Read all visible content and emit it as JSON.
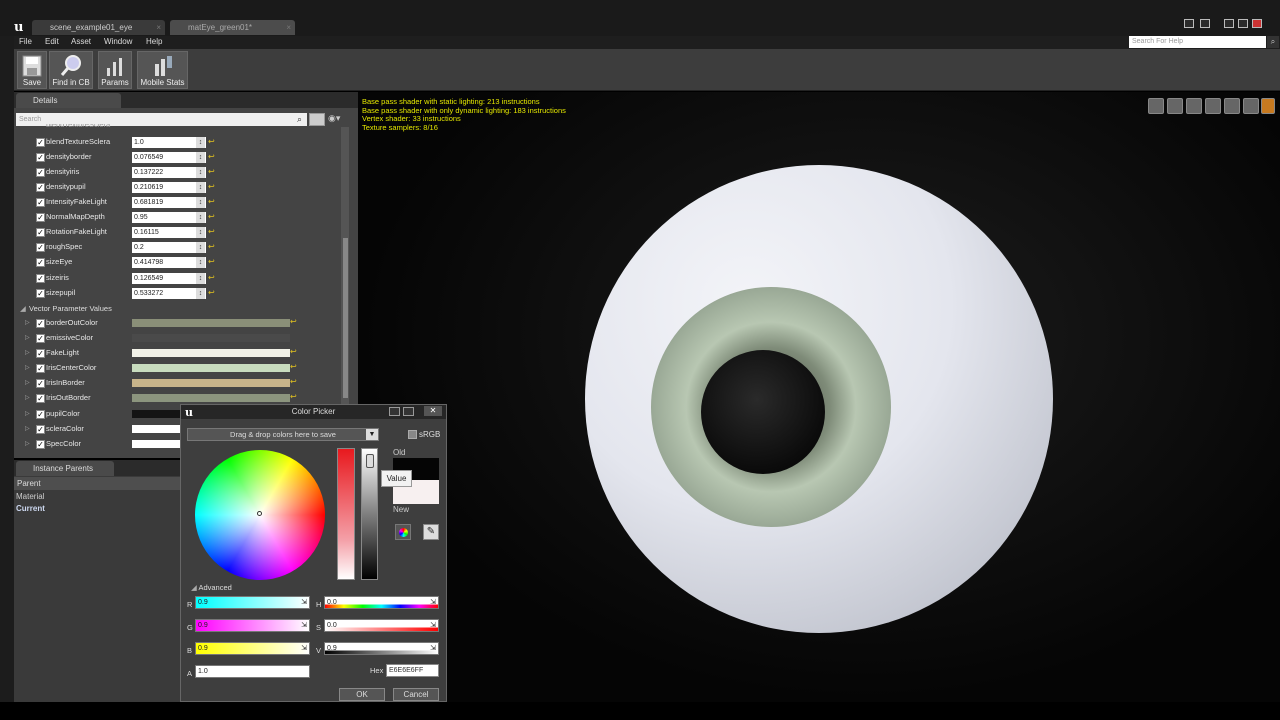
{
  "tabs": [
    {
      "label": "scene_example01_eye"
    },
    {
      "label": "matEye_green01*"
    }
  ],
  "menu": [
    "File",
    "Edit",
    "Asset",
    "Window",
    "Help"
  ],
  "help_search_placeholder": "Search For Help",
  "toolbar": [
    {
      "label": "Save"
    },
    {
      "label": "Find in CB"
    },
    {
      "label": "Params"
    },
    {
      "label": "Mobile Stats"
    }
  ],
  "details": {
    "tab": "Details",
    "search_placeholder": "Search",
    "partial_top": "blendTextureSclera",
    "scalars": [
      {
        "name": "blendTextureSclera",
        "value": "1.0"
      },
      {
        "name": "densityborder",
        "value": "0.076549"
      },
      {
        "name": "densityiris",
        "value": "0.137222"
      },
      {
        "name": "densitypupil",
        "value": "0.210619"
      },
      {
        "name": "IntensityFakeLight",
        "value": "0.681819"
      },
      {
        "name": "NormalMapDepth",
        "value": "0.95"
      },
      {
        "name": "RotationFakeLight",
        "value": "0.16115"
      },
      {
        "name": "roughSpec",
        "value": "0.2"
      },
      {
        "name": "sizeEye",
        "value": "0.414798"
      },
      {
        "name": "sizeiris",
        "value": "0.126549"
      },
      {
        "name": "sizepupil",
        "value": "0.533272"
      }
    ],
    "vector_header": "Vector Parameter Values",
    "vectors": [
      {
        "name": "borderOutColor",
        "color": "#8a8f78"
      },
      {
        "name": "emissiveColor",
        "color": "#4a4a4a"
      },
      {
        "name": "FakeLight",
        "color": "#f2f2e8"
      },
      {
        "name": "IrisCenterColor",
        "color": "#c8dcbe"
      },
      {
        "name": "IrisInBorder",
        "color": "#c8b48a"
      },
      {
        "name": "IrisOutBorder",
        "color": "#8c957e"
      },
      {
        "name": "pupilColor",
        "color": "#141414"
      },
      {
        "name": "scleraColor",
        "color": "#ffffff"
      },
      {
        "name": "SpecColor",
        "color": "#ffffff"
      }
    ]
  },
  "instance_parents": {
    "tab": "Instance Parents",
    "header": "Parent",
    "rows": [
      "Material",
      "Current"
    ]
  },
  "stats": [
    "Base pass shader with static lighting: 213 instructions",
    "Base pass shader with only dynamic lighting: 183 instructions",
    "Vertex shader: 33 instructions",
    "Texture samplers: 8/16"
  ],
  "color_picker": {
    "title": "Color Picker",
    "drag_drop": "Drag & drop colors here to save",
    "srgb": "sRGB",
    "old": "Old",
    "new": "New",
    "value_tip": "Value",
    "advanced": "Advanced",
    "channels": [
      {
        "label": "R",
        "value": "0.9"
      },
      {
        "label": "G",
        "value": "0.9"
      },
      {
        "label": "B",
        "value": "0.9"
      },
      {
        "label": "A",
        "value": "1.0"
      }
    ],
    "hsv": [
      {
        "label": "H",
        "value": "0.0"
      },
      {
        "label": "S",
        "value": "0.0"
      },
      {
        "label": "V",
        "value": "0.9"
      }
    ],
    "hex_label": "Hex",
    "hex": "E6E6E6FF",
    "ok": "OK",
    "cancel": "Cancel"
  }
}
